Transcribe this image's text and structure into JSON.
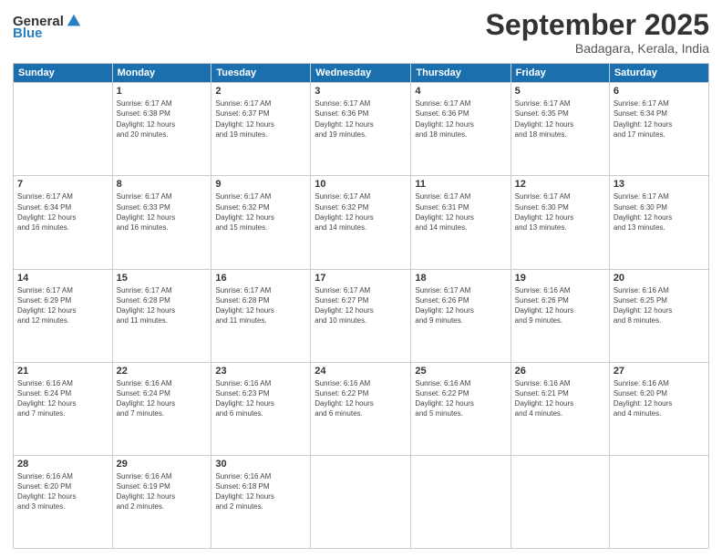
{
  "header": {
    "logo_general": "General",
    "logo_blue": "Blue",
    "title": "September 2025",
    "location": "Badagara, Kerala, India"
  },
  "columns": [
    "Sunday",
    "Monday",
    "Tuesday",
    "Wednesday",
    "Thursday",
    "Friday",
    "Saturday"
  ],
  "weeks": [
    [
      {
        "day": "",
        "info": ""
      },
      {
        "day": "1",
        "info": "Sunrise: 6:17 AM\nSunset: 6:38 PM\nDaylight: 12 hours\nand 20 minutes."
      },
      {
        "day": "2",
        "info": "Sunrise: 6:17 AM\nSunset: 6:37 PM\nDaylight: 12 hours\nand 19 minutes."
      },
      {
        "day": "3",
        "info": "Sunrise: 6:17 AM\nSunset: 6:36 PM\nDaylight: 12 hours\nand 19 minutes."
      },
      {
        "day": "4",
        "info": "Sunrise: 6:17 AM\nSunset: 6:36 PM\nDaylight: 12 hours\nand 18 minutes."
      },
      {
        "day": "5",
        "info": "Sunrise: 6:17 AM\nSunset: 6:35 PM\nDaylight: 12 hours\nand 18 minutes."
      },
      {
        "day": "6",
        "info": "Sunrise: 6:17 AM\nSunset: 6:34 PM\nDaylight: 12 hours\nand 17 minutes."
      }
    ],
    [
      {
        "day": "7",
        "info": "Sunrise: 6:17 AM\nSunset: 6:34 PM\nDaylight: 12 hours\nand 16 minutes."
      },
      {
        "day": "8",
        "info": "Sunrise: 6:17 AM\nSunset: 6:33 PM\nDaylight: 12 hours\nand 16 minutes."
      },
      {
        "day": "9",
        "info": "Sunrise: 6:17 AM\nSunset: 6:32 PM\nDaylight: 12 hours\nand 15 minutes."
      },
      {
        "day": "10",
        "info": "Sunrise: 6:17 AM\nSunset: 6:32 PM\nDaylight: 12 hours\nand 14 minutes."
      },
      {
        "day": "11",
        "info": "Sunrise: 6:17 AM\nSunset: 6:31 PM\nDaylight: 12 hours\nand 14 minutes."
      },
      {
        "day": "12",
        "info": "Sunrise: 6:17 AM\nSunset: 6:30 PM\nDaylight: 12 hours\nand 13 minutes."
      },
      {
        "day": "13",
        "info": "Sunrise: 6:17 AM\nSunset: 6:30 PM\nDaylight: 12 hours\nand 13 minutes."
      }
    ],
    [
      {
        "day": "14",
        "info": "Sunrise: 6:17 AM\nSunset: 6:29 PM\nDaylight: 12 hours\nand 12 minutes."
      },
      {
        "day": "15",
        "info": "Sunrise: 6:17 AM\nSunset: 6:28 PM\nDaylight: 12 hours\nand 11 minutes."
      },
      {
        "day": "16",
        "info": "Sunrise: 6:17 AM\nSunset: 6:28 PM\nDaylight: 12 hours\nand 11 minutes."
      },
      {
        "day": "17",
        "info": "Sunrise: 6:17 AM\nSunset: 6:27 PM\nDaylight: 12 hours\nand 10 minutes."
      },
      {
        "day": "18",
        "info": "Sunrise: 6:17 AM\nSunset: 6:26 PM\nDaylight: 12 hours\nand 9 minutes."
      },
      {
        "day": "19",
        "info": "Sunrise: 6:16 AM\nSunset: 6:26 PM\nDaylight: 12 hours\nand 9 minutes."
      },
      {
        "day": "20",
        "info": "Sunrise: 6:16 AM\nSunset: 6:25 PM\nDaylight: 12 hours\nand 8 minutes."
      }
    ],
    [
      {
        "day": "21",
        "info": "Sunrise: 6:16 AM\nSunset: 6:24 PM\nDaylight: 12 hours\nand 7 minutes."
      },
      {
        "day": "22",
        "info": "Sunrise: 6:16 AM\nSunset: 6:24 PM\nDaylight: 12 hours\nand 7 minutes."
      },
      {
        "day": "23",
        "info": "Sunrise: 6:16 AM\nSunset: 6:23 PM\nDaylight: 12 hours\nand 6 minutes."
      },
      {
        "day": "24",
        "info": "Sunrise: 6:16 AM\nSunset: 6:22 PM\nDaylight: 12 hours\nand 6 minutes."
      },
      {
        "day": "25",
        "info": "Sunrise: 6:16 AM\nSunset: 6:22 PM\nDaylight: 12 hours\nand 5 minutes."
      },
      {
        "day": "26",
        "info": "Sunrise: 6:16 AM\nSunset: 6:21 PM\nDaylight: 12 hours\nand 4 minutes."
      },
      {
        "day": "27",
        "info": "Sunrise: 6:16 AM\nSunset: 6:20 PM\nDaylight: 12 hours\nand 4 minutes."
      }
    ],
    [
      {
        "day": "28",
        "info": "Sunrise: 6:16 AM\nSunset: 6:20 PM\nDaylight: 12 hours\nand 3 minutes."
      },
      {
        "day": "29",
        "info": "Sunrise: 6:16 AM\nSunset: 6:19 PM\nDaylight: 12 hours\nand 2 minutes."
      },
      {
        "day": "30",
        "info": "Sunrise: 6:16 AM\nSunset: 6:18 PM\nDaylight: 12 hours\nand 2 minutes."
      },
      {
        "day": "",
        "info": ""
      },
      {
        "day": "",
        "info": ""
      },
      {
        "day": "",
        "info": ""
      },
      {
        "day": "",
        "info": ""
      }
    ]
  ]
}
